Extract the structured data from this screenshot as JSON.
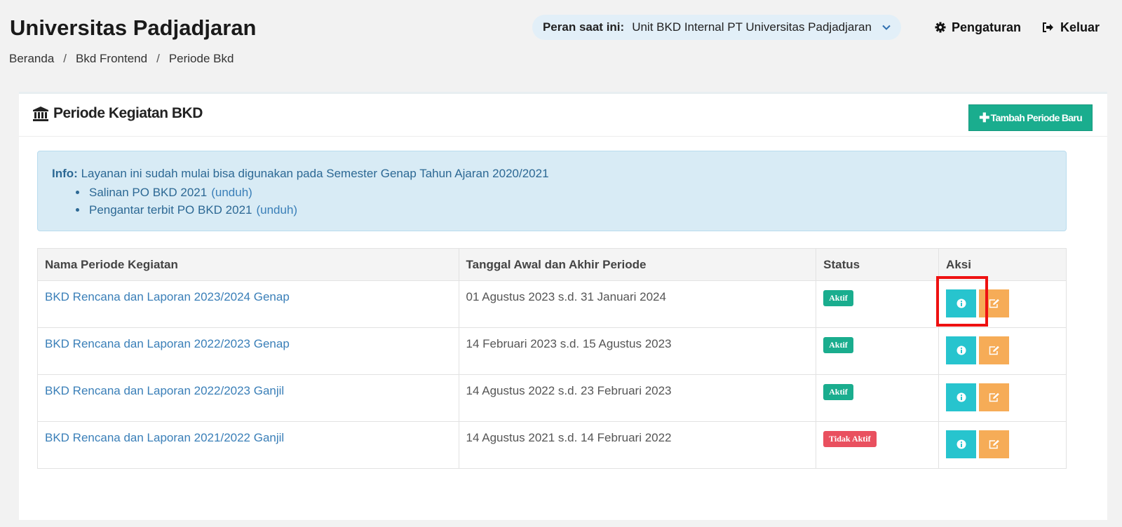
{
  "header": {
    "app_title": "Universitas Padjadjaran",
    "role_label": "Peran saat ini:",
    "role_value": "Unit BKD Internal PT Universitas Padjadjaran",
    "settings_label": "Pengaturan",
    "logout_label": "Keluar"
  },
  "breadcrumb": {
    "items": [
      "Beranda",
      "Bkd Frontend",
      "Periode Bkd"
    ],
    "separator": "/"
  },
  "panel": {
    "title": "Periode Kegiatan BKD",
    "add_button_label": "Tambah Periode Baru"
  },
  "info": {
    "prefix": "Info:",
    "text": "Layanan ini sudah mulai bisa digunakan pada Semester Genap Tahun Ajaran 2020/2021",
    "items": [
      {
        "text": "Salinan PO BKD 2021",
        "link": "(unduh)"
      },
      {
        "text": "Pengantar terbit PO BKD 2021",
        "link": "(unduh)"
      }
    ]
  },
  "table": {
    "headers": [
      "Nama Periode Kegiatan",
      "Tanggal Awal dan Akhir Periode",
      "Status",
      "Aksi"
    ],
    "rows": [
      {
        "name": "BKD Rencana dan Laporan 2023/2024 Genap",
        "period": "01 Agustus 2023 s.d. 31 Januari 2024",
        "status": "Aktif"
      },
      {
        "name": "BKD Rencana dan Laporan 2022/2023 Genap",
        "period": "14 Februari 2023 s.d. 15 Agustus 2023",
        "status": "Aktif"
      },
      {
        "name": "BKD Rencana dan Laporan 2022/2023 Ganjil",
        "period": "14 Agustus 2022 s.d. 23 Februari 2023",
        "status": "Aktif"
      },
      {
        "name": "BKD Rencana dan Laporan 2021/2022 Ganjil",
        "period": "14 Agustus 2021 s.d. 14 Februari 2022",
        "status": "Tidak Aktif"
      }
    ]
  },
  "colors": {
    "accent_green": "#1aad8e",
    "info_button": "#27c4ce",
    "edit_button": "#f6ac57",
    "inactive_badge": "#e9505f",
    "highlight_box": "#ee1111"
  },
  "icons": {
    "settings": "gear-icon",
    "logout": "sign-out-icon",
    "panel": "institution-icon",
    "role_dropdown": "chevron-down-icon",
    "row_info": "info-circle-icon",
    "row_edit": "edit-icon"
  }
}
